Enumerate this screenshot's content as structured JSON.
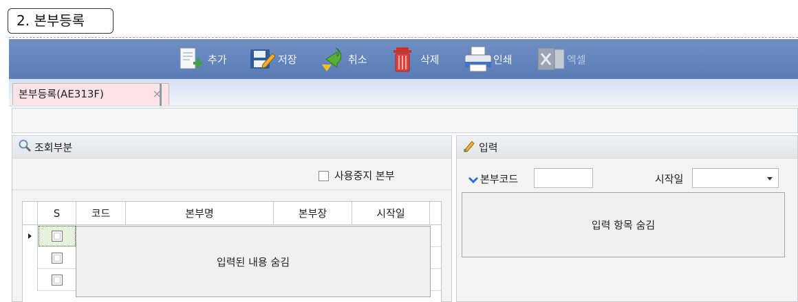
{
  "page": {
    "section_label": "2. 본부등록"
  },
  "toolbar": {
    "buttons": [
      {
        "label": "추가",
        "icon": "add-document-icon"
      },
      {
        "label": "저장",
        "icon": "save-icon"
      },
      {
        "label": "취소",
        "icon": "undo-arrow-icon"
      },
      {
        "label": "삭제",
        "icon": "trash-icon"
      },
      {
        "label": "인쇄",
        "icon": "printer-icon"
      },
      {
        "label": "엑셀",
        "icon": "excel-icon"
      }
    ]
  },
  "tabs": [
    {
      "label": "본부등록(AE313F)",
      "close": "×"
    }
  ],
  "search_panel": {
    "title": "조회부분",
    "filter_checkbox_label": "사용중지 본부",
    "columns": [
      "S",
      "코드",
      "본부명",
      "본부장",
      "시작일"
    ],
    "hidden_notice": "입력된 내용 숨김"
  },
  "input_panel": {
    "title": "입력",
    "code_label": "본부코드",
    "code_value": "",
    "start_label": "시작일",
    "start_value": "",
    "hidden_notice": "입력 항목 숨김"
  },
  "colors": {
    "toolbar": "#5a7bb6",
    "tab_active": "#fbe3e6",
    "accent_blue": "#2f6fd0"
  }
}
